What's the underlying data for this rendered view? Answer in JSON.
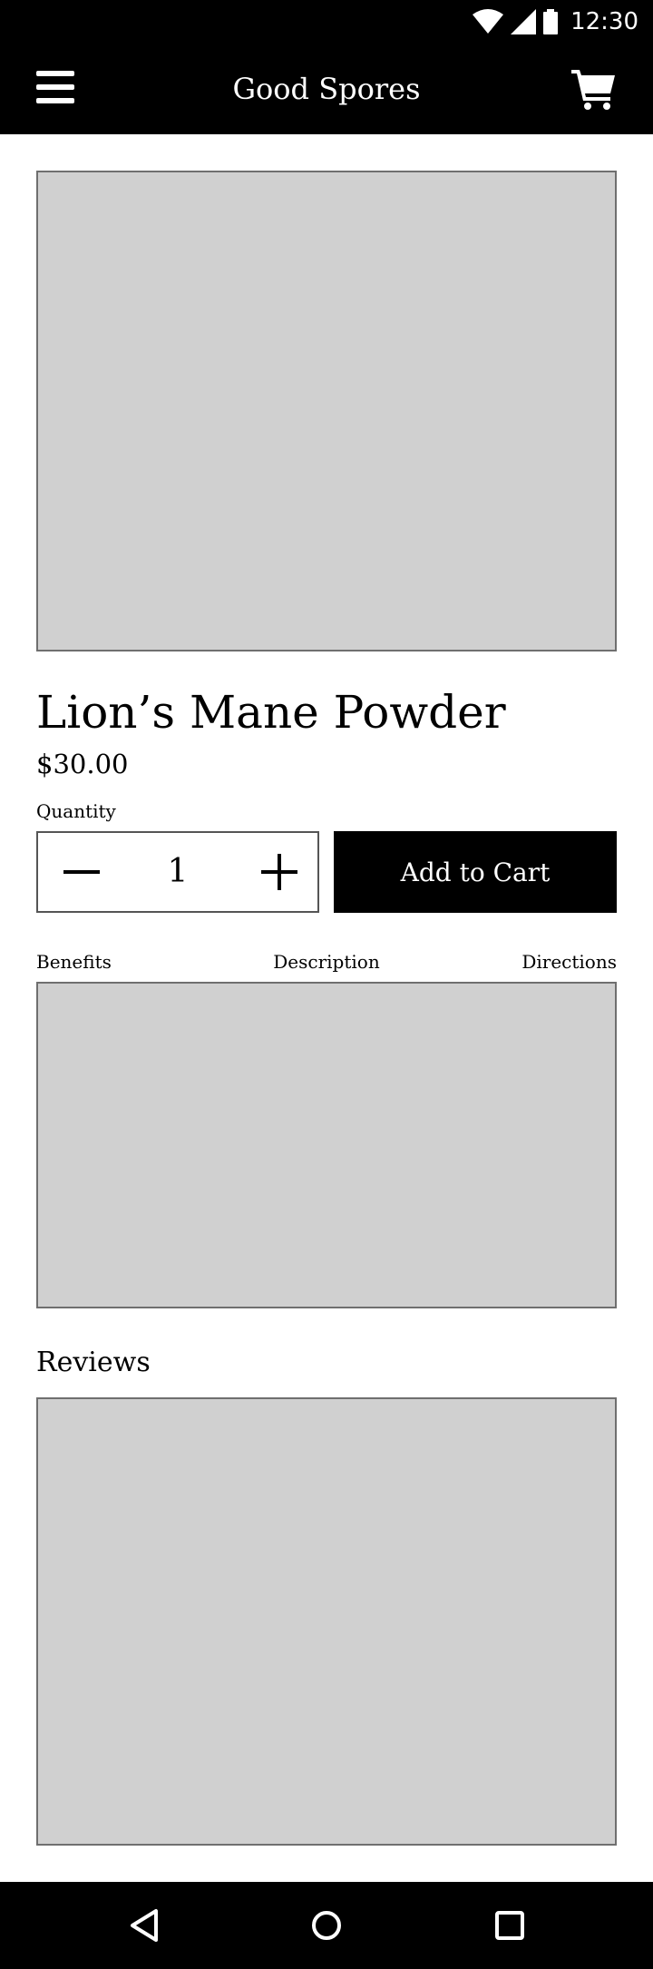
{
  "status_bar": {
    "time": "12:30",
    "icons": [
      "wifi-icon",
      "cellular-signal-icon",
      "battery-icon"
    ]
  },
  "app_bar": {
    "title": "Good Spores",
    "menu_icon": "hamburger-menu-icon",
    "cart_icon": "shopping-cart-icon"
  },
  "product": {
    "name": "Lion’s Mane Powder",
    "price": "$30.00",
    "quantity_label": "Quantity",
    "quantity": "1",
    "add_to_cart_label": "Add to Cart"
  },
  "tabs": [
    {
      "label": "Benefits"
    },
    {
      "label": "Description"
    },
    {
      "label": "Directions"
    }
  ],
  "reviews": {
    "heading": "Reviews"
  },
  "nav_bar": {
    "icons": [
      "back-icon",
      "home-icon",
      "recents-icon"
    ]
  },
  "colors": {
    "bar_background": "#000000",
    "placeholder_fill": "#d0d0d0",
    "placeholder_border": "#6f6f6f"
  }
}
